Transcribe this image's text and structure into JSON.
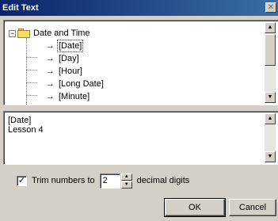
{
  "window": {
    "title": "Edit Text"
  },
  "tree": {
    "root_label": "Date and Time",
    "items": [
      {
        "label": "[Date]",
        "selected": true
      },
      {
        "label": "[Day]"
      },
      {
        "label": "[Hour]"
      },
      {
        "label": "[Long Date]"
      },
      {
        "label": "[Minute]"
      }
    ]
  },
  "text_area": {
    "lines": [
      "[Date]",
      "Lesson 4"
    ]
  },
  "trim": {
    "checked": true,
    "label": "Trim numbers to",
    "value": "2",
    "suffix": "decimal digits"
  },
  "buttons": {
    "ok": "OK",
    "cancel": "Cancel"
  }
}
